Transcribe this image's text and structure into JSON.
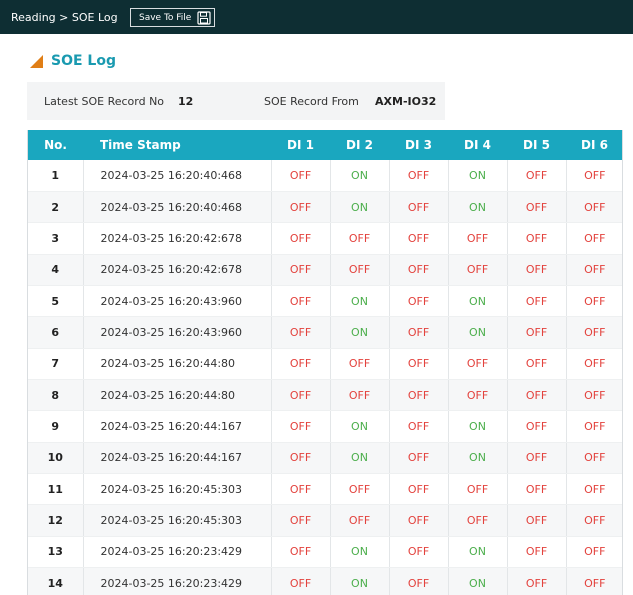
{
  "header": {
    "breadcrumb": "Reading > SOE Log",
    "save_button_label": "Save To File"
  },
  "section": {
    "title": "SOE Log"
  },
  "info": {
    "latest_label": "Latest SOE Record No",
    "latest_value": "12",
    "from_label": "SOE Record From",
    "from_value": "AXM-IO32"
  },
  "colors": {
    "topbar": "#0e2e33",
    "accent": "#1aa7bf",
    "title": "#1a9ab0",
    "triangle": "#e07e16",
    "off": "#e3423d",
    "on": "#4cae4c"
  },
  "table": {
    "columns": [
      "No.",
      "Time Stamp",
      "DI 1",
      "DI 2",
      "DI 3",
      "DI 4",
      "DI 5",
      "DI 6"
    ],
    "rows": [
      {
        "no": "1",
        "ts": "2024-03-25 16:20:40:468",
        "di": [
          "OFF",
          "ON",
          "OFF",
          "ON",
          "OFF",
          "OFF"
        ]
      },
      {
        "no": "2",
        "ts": "2024-03-25 16:20:40:468",
        "di": [
          "OFF",
          "ON",
          "OFF",
          "ON",
          "OFF",
          "OFF"
        ]
      },
      {
        "no": "3",
        "ts": "2024-03-25 16:20:42:678",
        "di": [
          "OFF",
          "OFF",
          "OFF",
          "OFF",
          "OFF",
          "OFF"
        ]
      },
      {
        "no": "4",
        "ts": "2024-03-25 16:20:42:678",
        "di": [
          "OFF",
          "OFF",
          "OFF",
          "OFF",
          "OFF",
          "OFF"
        ]
      },
      {
        "no": "5",
        "ts": "2024-03-25 16:20:43:960",
        "di": [
          "OFF",
          "ON",
          "OFF",
          "ON",
          "OFF",
          "OFF"
        ]
      },
      {
        "no": "6",
        "ts": "2024-03-25 16:20:43:960",
        "di": [
          "OFF",
          "ON",
          "OFF",
          "ON",
          "OFF",
          "OFF"
        ]
      },
      {
        "no": "7",
        "ts": "2024-03-25 16:20:44:80",
        "di": [
          "OFF",
          "OFF",
          "OFF",
          "OFF",
          "OFF",
          "OFF"
        ]
      },
      {
        "no": "8",
        "ts": "2024-03-25 16:20:44:80",
        "di": [
          "OFF",
          "OFF",
          "OFF",
          "OFF",
          "OFF",
          "OFF"
        ]
      },
      {
        "no": "9",
        "ts": "2024-03-25 16:20:44:167",
        "di": [
          "OFF",
          "ON",
          "OFF",
          "ON",
          "OFF",
          "OFF"
        ]
      },
      {
        "no": "10",
        "ts": "2024-03-25 16:20:44:167",
        "di": [
          "OFF",
          "ON",
          "OFF",
          "ON",
          "OFF",
          "OFF"
        ]
      },
      {
        "no": "11",
        "ts": "2024-03-25 16:20:45:303",
        "di": [
          "OFF",
          "OFF",
          "OFF",
          "OFF",
          "OFF",
          "OFF"
        ]
      },
      {
        "no": "12",
        "ts": "2024-03-25 16:20:45:303",
        "di": [
          "OFF",
          "OFF",
          "OFF",
          "OFF",
          "OFF",
          "OFF"
        ]
      },
      {
        "no": "13",
        "ts": "2024-03-25 16:20:23:429",
        "di": [
          "OFF",
          "ON",
          "OFF",
          "ON",
          "OFF",
          "OFF"
        ]
      },
      {
        "no": "14",
        "ts": "2024-03-25 16:20:23:429",
        "di": [
          "OFF",
          "ON",
          "OFF",
          "ON",
          "OFF",
          "OFF"
        ]
      }
    ]
  }
}
